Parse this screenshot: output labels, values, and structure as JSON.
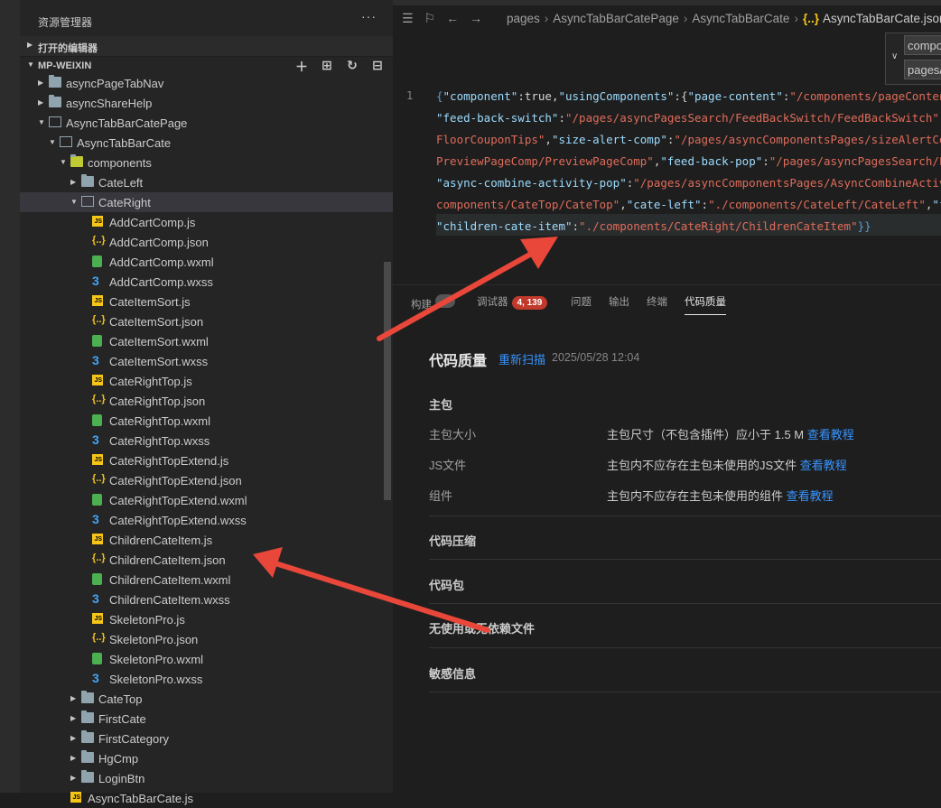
{
  "explorer": {
    "title": "资源管理器",
    "more": "···",
    "sections": {
      "open_editors": "打开的编辑器",
      "project": "MP-WEIXIN"
    },
    "project_actions": [
      "new-file-icon",
      "new-folder-icon",
      "refresh-icon",
      "collapse-all-icon"
    ],
    "tree": [
      {
        "label": "asyncPageTabNav",
        "type": "folder",
        "depth": 2,
        "expanded": false
      },
      {
        "label": "asyncShareHelp",
        "type": "folder",
        "depth": 2,
        "expanded": false
      },
      {
        "label": "AsyncTabBarCatePage",
        "type": "folder",
        "depth": 2,
        "expanded": true
      },
      {
        "label": "AsyncTabBarCate",
        "type": "folder",
        "depth": 3,
        "expanded": true
      },
      {
        "label": "components",
        "type": "components-folder",
        "depth": 4,
        "expanded": true
      },
      {
        "label": "CateLeft",
        "type": "folder",
        "depth": 5,
        "expanded": false
      },
      {
        "label": "CateRight",
        "type": "folder",
        "depth": 5,
        "expanded": true,
        "selected": true
      },
      {
        "label": "AddCartComp.js",
        "type": "js",
        "depth": 6
      },
      {
        "label": "AddCartComp.json",
        "type": "json",
        "depth": 6
      },
      {
        "label": "AddCartComp.wxml",
        "type": "wxml",
        "depth": 6
      },
      {
        "label": "AddCartComp.wxss",
        "type": "wxss",
        "depth": 6
      },
      {
        "label": "CateItemSort.js",
        "type": "js",
        "depth": 6
      },
      {
        "label": "CateItemSort.json",
        "type": "json",
        "depth": 6
      },
      {
        "label": "CateItemSort.wxml",
        "type": "wxml",
        "depth": 6
      },
      {
        "label": "CateItemSort.wxss",
        "type": "wxss",
        "depth": 6
      },
      {
        "label": "CateRightTop.js",
        "type": "js",
        "depth": 6
      },
      {
        "label": "CateRightTop.json",
        "type": "json",
        "depth": 6
      },
      {
        "label": "CateRightTop.wxml",
        "type": "wxml",
        "depth": 6
      },
      {
        "label": "CateRightTop.wxss",
        "type": "wxss",
        "depth": 6
      },
      {
        "label": "CateRightTopExtend.js",
        "type": "js",
        "depth": 6
      },
      {
        "label": "CateRightTopExtend.json",
        "type": "json",
        "depth": 6
      },
      {
        "label": "CateRightTopExtend.wxml",
        "type": "wxml",
        "depth": 6
      },
      {
        "label": "CateRightTopExtend.wxss",
        "type": "wxss",
        "depth": 6
      },
      {
        "label": "ChildrenCateItem.js",
        "type": "js",
        "depth": 6
      },
      {
        "label": "ChildrenCateItem.json",
        "type": "json",
        "depth": 6
      },
      {
        "label": "ChildrenCateItem.wxml",
        "type": "wxml",
        "depth": 6
      },
      {
        "label": "ChildrenCateItem.wxss",
        "type": "wxss",
        "depth": 6
      },
      {
        "label": "SkeletonPro.js",
        "type": "js",
        "depth": 6
      },
      {
        "label": "SkeletonPro.json",
        "type": "json",
        "depth": 6
      },
      {
        "label": "SkeletonPro.wxml",
        "type": "wxml",
        "depth": 6
      },
      {
        "label": "SkeletonPro.wxss",
        "type": "wxss",
        "depth": 6
      },
      {
        "label": "CateTop",
        "type": "folder",
        "depth": 5,
        "expanded": false
      },
      {
        "label": "FirstCate",
        "type": "folder",
        "depth": 5,
        "expanded": false
      },
      {
        "label": "FirstCategory",
        "type": "folder",
        "depth": 5,
        "expanded": false
      },
      {
        "label": "HgCmp",
        "type": "folder",
        "depth": 5,
        "expanded": false
      },
      {
        "label": "LoginBtn",
        "type": "folder",
        "depth": 5,
        "expanded": false
      },
      {
        "label": "AsyncTabBarCate.js",
        "type": "js",
        "depth": 4
      }
    ]
  },
  "breadcrumb": {
    "items": [
      "pages",
      "AsyncTabBarCatePage",
      "AsyncTabBarCate"
    ],
    "file_icon": "{..}",
    "file": "AsyncTabBarCate.json"
  },
  "suggest": {
    "options": [
      "compo",
      "pages/"
    ]
  },
  "editor": {
    "line_number": "1",
    "lines": [
      [
        [
          "b",
          "{"
        ],
        [
          "k",
          "\"component\""
        ],
        [
          "p",
          ":true,"
        ],
        [
          "k",
          "\"usingComponents\""
        ],
        [
          "p",
          ":{"
        ],
        [
          "k",
          "\"page-content\""
        ],
        [
          "p",
          ":"
        ],
        [
          "s",
          "\"/components/pageContent/p"
        ]
      ],
      [
        [
          "k",
          "\"feed-back-switch\""
        ],
        [
          "p",
          ":"
        ],
        [
          "s",
          "\"/pages/asyncPagesSearch/FeedBackSwitch/FeedBackSwitch\""
        ],
        [
          "p",
          ","
        ],
        [
          "k",
          "\"fl"
        ]
      ],
      [
        [
          "s",
          "FloorCouponTips\""
        ],
        [
          "p",
          ","
        ],
        [
          "k",
          "\"size-alert-comp\""
        ],
        [
          "p",
          ":"
        ],
        [
          "s",
          "\"/pages/asyncComponentsPages/sizeAlertComp/"
        ]
      ],
      [
        [
          "s",
          "PreviewPageComp/PreviewPageComp\""
        ],
        [
          "p",
          ","
        ],
        [
          "k",
          "\"feed-back-pop\""
        ],
        [
          "p",
          ":"
        ],
        [
          "s",
          "\"/pages/asyncPagesSearch/Feed"
        ]
      ],
      [
        [
          "k",
          "\"async-combine-activity-pop\""
        ],
        [
          "p",
          ":"
        ],
        [
          "s",
          "\"/pages/asyncComponentsPages/AsyncCombineActivity"
        ]
      ],
      [
        [
          "s",
          "components/CateTop/CateTop\""
        ],
        [
          "p",
          ","
        ],
        [
          "k",
          "\"cate-left\""
        ],
        [
          "p",
          ":"
        ],
        [
          "s",
          "\"./components/CateLeft/CateLeft\""
        ],
        [
          "p",
          ","
        ],
        [
          "k",
          "\"firs"
        ]
      ],
      [
        [
          "k",
          "\"children-cate-item\""
        ],
        [
          "p",
          ":"
        ],
        [
          "s",
          "\"./components/CateRight/ChildrenCateItem\""
        ],
        [
          "b",
          "}}"
        ]
      ]
    ]
  },
  "panel": {
    "tabs": [
      {
        "label": "构建",
        "badge": "",
        "badge_style": "grey"
      },
      {
        "label": "调试器",
        "badge": "4, 139",
        "badge_style": "red"
      },
      {
        "label": "问题"
      },
      {
        "label": "输出"
      },
      {
        "label": "终端"
      },
      {
        "label": "代码质量",
        "active": true
      }
    ],
    "code_quality": {
      "title": "代码质量",
      "rescan": "重新扫描",
      "timestamp": "2025/05/28 12:04",
      "main_package": {
        "title": "主包",
        "items": [
          {
            "label": "主包大小",
            "desc": "主包尺寸（不包含插件）应小于 1.5 M",
            "link": "查看教程"
          },
          {
            "label": "JS文件",
            "desc": "主包内不应存在主包未使用的JS文件",
            "link": "查看教程"
          },
          {
            "label": "组件",
            "desc": "主包内不应存在主包未使用的组件",
            "link": "查看教程"
          }
        ]
      },
      "groups": [
        "代码压缩",
        "代码包",
        "无使用或无依赖文件",
        "敏感信息"
      ]
    }
  },
  "colors": {
    "arrow": "#e8473a",
    "link": "#3794ff",
    "badge_red": "#c0392b"
  }
}
